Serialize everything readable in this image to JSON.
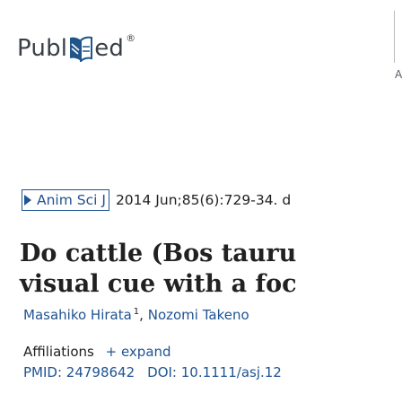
{
  "header": {
    "logo_text_before": "Publ",
    "logo_text_after": "ed",
    "logo_registered": "®",
    "edge_glyph": "A"
  },
  "citation": {
    "journal": "Anim Sci J",
    "details": "2014 Jun;85(6):729-34. d"
  },
  "article": {
    "title_line_1": "Do cattle (Bos tauru",
    "title_line_2": "visual cue with a foc",
    "authors": [
      {
        "name": "Masahiko Hirata",
        "sup": "1"
      },
      {
        "name": "Nozomi Takeno",
        "sup": ""
      }
    ],
    "affiliations_label": "Affiliations",
    "expand_label": "+ expand",
    "pmid": "PMID: 24798642",
    "doi": "DOI: 10.1111/asj.12"
  },
  "colors": {
    "link": "#205493",
    "text": "#212121",
    "logo": "#3a3f47"
  }
}
